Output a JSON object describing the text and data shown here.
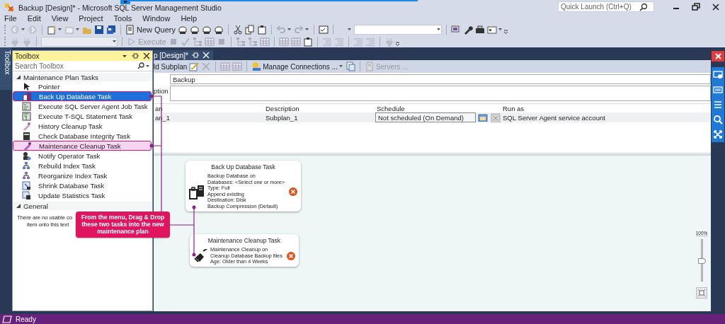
{
  "window": {
    "title": "Backup [Design]* - Microsoft SQL Server Management Studio",
    "quick_launch": {
      "placeholder": "Quick Launch (Ctrl+Q)"
    }
  },
  "menu": [
    "File",
    "Edit",
    "View",
    "Project",
    "Tools",
    "Window",
    "Help"
  ],
  "toolbar": {
    "new_query": "New Query"
  },
  "toolbar_2": {
    "execute": {
      "label": "Execute",
      "disabled": true
    }
  },
  "toolbox": {
    "side_tab": "Toolbox",
    "title": "Toolbox",
    "search": {
      "placeholder": "Search Toolbox"
    },
    "groups": [
      {
        "label": "Maintenance Plan Tasks",
        "expanded": true,
        "items": [
          {
            "label": "Pointer",
            "selected": false,
            "marked": false
          },
          {
            "label": "Back Up Database Task",
            "selected": true,
            "marked": true
          },
          {
            "label": "Execute SQL Server Agent Job Task",
            "selected": false,
            "marked": false
          },
          {
            "label": "Execute T-SQL Statement Task",
            "selected": false,
            "marked": false
          },
          {
            "label": "History Cleanup Task",
            "selected": false,
            "marked": false
          },
          {
            "label": "Check Database Integrity Task",
            "selected": false,
            "marked": false
          },
          {
            "label": "Maintenance Cleanup Task",
            "selected": false,
            "marked": true
          },
          {
            "label": "Notify Operator Task",
            "selected": false,
            "marked": false
          },
          {
            "label": "Rebuild Index Task",
            "selected": false,
            "marked": false
          },
          {
            "label": "Reorganize Index Task",
            "selected": false,
            "marked": false
          },
          {
            "label": "Shrink Database Task",
            "selected": false,
            "marked": false
          },
          {
            "label": "Update Statistics Task",
            "selected": false,
            "marked": false
          }
        ]
      },
      {
        "label": "General",
        "expanded": true,
        "message": [
          "There are no usable co",
          "item onto this text"
        ]
      }
    ]
  },
  "document": {
    "tab": {
      "label": "p [Design]*",
      "selected": true
    },
    "toolbar": {
      "add_subplan": "ld Subplan",
      "manage_connections": "Manage Connections ...",
      "servers": "Servers ..."
    },
    "name_value": "Backup",
    "description_label": "ption",
    "subplans": {
      "columns": [
        "an",
        "Description",
        "Schedule",
        "Run as"
      ],
      "rows": [
        {
          "name": "an_1",
          "description": "Subplan_1",
          "schedule": "Not scheduled (On Demand)",
          "run_as": "SQL Server Agent service account"
        }
      ]
    },
    "canvas": {
      "tasks": [
        {
          "kind": "backup",
          "title": "Back Up Database Task",
          "lines": [
            "Backup Database on",
            "Databases: <Select one or more>",
            "Type: Full",
            "Append existing",
            "Destination: Disk",
            "Backup Compression (Default)"
          ],
          "error": true
        },
        {
          "kind": "cleanup",
          "title": "Maintenance Cleanup Task",
          "lines": [
            "Maintenance Cleanup on",
            "Cleanup Database Backup files",
            "Age: Older than 4 Weeks"
          ],
          "error": true
        }
      ],
      "zoom": {
        "label": "100%",
        "level": 0.5
      }
    }
  },
  "annotation": {
    "text": "From the menu, Drag & Drop these two tasks into the new maintenance plan"
  },
  "status_bar": {
    "text": "Ready"
  }
}
